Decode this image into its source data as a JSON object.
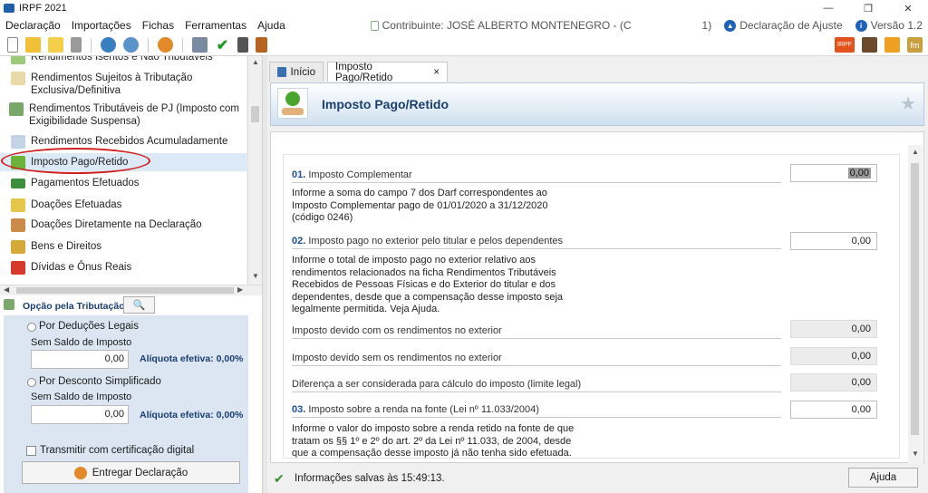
{
  "window": {
    "title": "IRPF 2021",
    "minimize": "—",
    "maximize": "❐",
    "close": "✕"
  },
  "menu": {
    "items": [
      "Declaração",
      "Importações",
      "Fichas",
      "Ferramentas",
      "Ajuda"
    ],
    "contribuinte": "Contribuinte: JOSÉ ALBERTO MONTENEGRO - (C",
    "contribuinte_tail": "1)",
    "declaracao_tipo": "Declaração de Ajuste",
    "versao": "Versão 1.2"
  },
  "sidebar": {
    "items": [
      {
        "label": "Rendimentos Isentos e Não Tributáveis",
        "icon": "green-check-doc-icon"
      },
      {
        "label": "Rendimentos Sujeitos à Tributação Exclusiva/Definitiva",
        "icon": "warning-doc-icon"
      },
      {
        "label": "Rendimentos Tributáveis de PJ (Imposto com Exigibilidade Suspensa)",
        "icon": "exchange-icon"
      },
      {
        "label": "Rendimentos Recebidos Acumuladamente",
        "icon": "doc-refresh-icon"
      },
      {
        "label": "Imposto Pago/Retido",
        "icon": "money-hand-icon"
      },
      {
        "label": "Pagamentos Efetuados",
        "icon": "card-icon"
      },
      {
        "label": "Doações Efetuadas",
        "icon": "money-doc-icon"
      },
      {
        "label": "Doações Diretamente na Declaração",
        "icon": "people-icon"
      },
      {
        "label": "Bens e Direitos",
        "icon": "money-bag-icon"
      },
      {
        "label": "Dívidas e Ônus Reais",
        "icon": "red-arrow-down-icon"
      }
    ]
  },
  "options": {
    "title": "Opção pela Tributação:",
    "deducoes_label": "Por Deduções Legais",
    "saldo_label": "Sem Saldo de Imposto",
    "deducoes_value": "0,00",
    "aliquota_label": "Alíquota efetiva: 0,00%",
    "simplificado_label": "Por Desconto Simplificado",
    "saldo_label2": "Sem Saldo de Imposto",
    "simplificado_value": "0,00",
    "aliquota_label2": "Alíquota efetiva: 0,00%",
    "transmitir_label": "Transmitir com certificação digital",
    "entregar_label": "Entregar Declaração"
  },
  "tabs": [
    {
      "label": "Início"
    },
    {
      "label": "Imposto Pago/Retido",
      "close": "×"
    }
  ],
  "header": {
    "title": "Imposto Pago/Retido"
  },
  "form": {
    "f01": {
      "num": "01.",
      "label": "Imposto Complementar",
      "value": "0,00",
      "desc": [
        "Informe a soma do campo 7 dos Darf correspondentes ao",
        "Imposto Complementar pago de 01/01/2020 a 31/12/2020",
        "(código 0246)"
      ]
    },
    "f02": {
      "num": "02.",
      "label": "Imposto pago no exterior pelo titular e pelos dependentes",
      "value": "0,00",
      "desc": [
        "Informe o total de imposto pago no exterior relativo aos",
        "rendimentos relacionados na ficha Rendimentos Tributáveis",
        "Recebidos de Pessoas Físicas e do Exterior do titular e dos",
        "dependentes, desde que a compensação desse imposto seja",
        "legalmente permitida. Veja Ajuda."
      ]
    },
    "r1": {
      "label": "Imposto devido com os rendimentos no exterior",
      "value": "0,00"
    },
    "r2": {
      "label": "Imposto devido sem os rendimentos no exterior",
      "value": "0,00"
    },
    "r3": {
      "label": "Diferença a ser considerada para cálculo do imposto (limite legal)",
      "value": "0,00"
    },
    "f03": {
      "num": "03.",
      "label": "Imposto sobre a renda na fonte (Lei nº 11.033/2004)",
      "value": "0,00",
      "desc": [
        "Informe o valor do imposto sobre a renda retido na fonte de que",
        "tratam os §§ 1º e 2º do art. 2º da Lei nº 11.033, de 2004, desde",
        "que a compensação desse imposto já não tenha sido efetuada."
      ]
    }
  },
  "status": {
    "message": "Informações salvas às 15:49:13.",
    "ajuda_label": "Ajuda"
  }
}
